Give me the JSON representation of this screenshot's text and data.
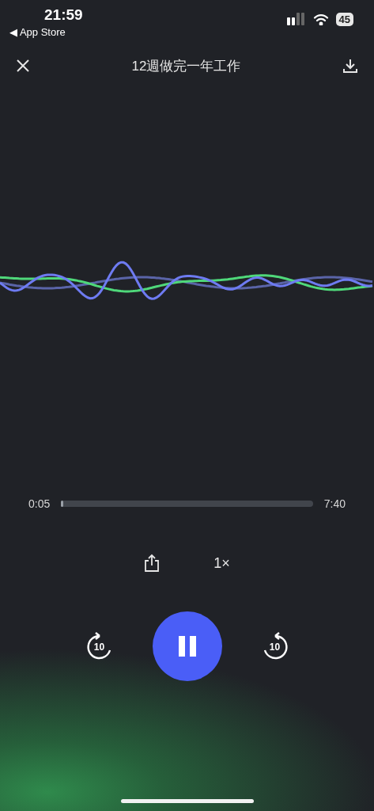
{
  "status_bar": {
    "time": "21:59",
    "back_label": "◀ App Store",
    "battery": "45"
  },
  "header": {
    "title": "12週做完一年工作"
  },
  "player": {
    "elapsed": "0:05",
    "total": "7:40",
    "level": 0.01,
    "speed": "1×",
    "skip_back": "10",
    "skip_forward": "10",
    "playing": true
  }
}
